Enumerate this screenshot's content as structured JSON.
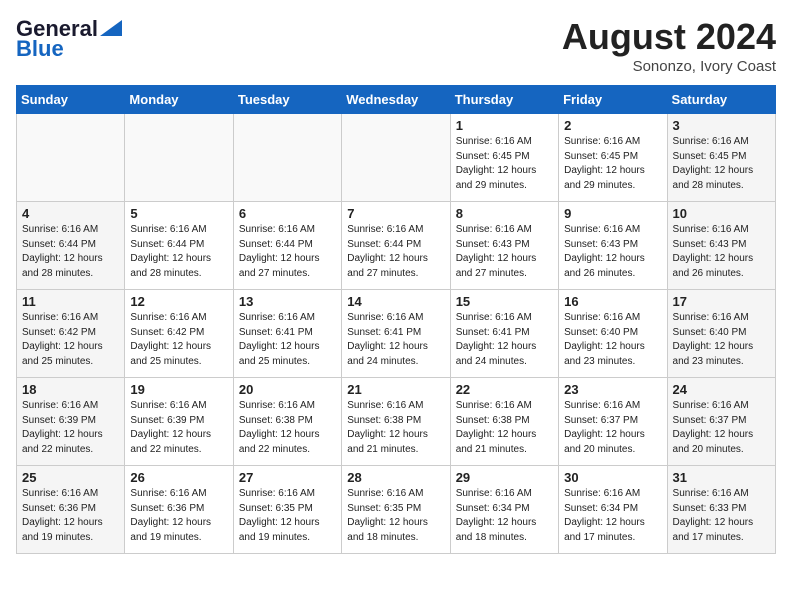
{
  "header": {
    "logo_line1": "General",
    "logo_line2": "Blue",
    "month_year": "August 2024",
    "location": "Sononzo, Ivory Coast"
  },
  "days_of_week": [
    "Sunday",
    "Monday",
    "Tuesday",
    "Wednesday",
    "Thursday",
    "Friday",
    "Saturday"
  ],
  "weeks": [
    [
      {
        "day": "",
        "info": ""
      },
      {
        "day": "",
        "info": ""
      },
      {
        "day": "",
        "info": ""
      },
      {
        "day": "",
        "info": ""
      },
      {
        "day": "1",
        "info": "Sunrise: 6:16 AM\nSunset: 6:45 PM\nDaylight: 12 hours\nand 29 minutes."
      },
      {
        "day": "2",
        "info": "Sunrise: 6:16 AM\nSunset: 6:45 PM\nDaylight: 12 hours\nand 29 minutes."
      },
      {
        "day": "3",
        "info": "Sunrise: 6:16 AM\nSunset: 6:45 PM\nDaylight: 12 hours\nand 28 minutes."
      }
    ],
    [
      {
        "day": "4",
        "info": "Sunrise: 6:16 AM\nSunset: 6:44 PM\nDaylight: 12 hours\nand 28 minutes."
      },
      {
        "day": "5",
        "info": "Sunrise: 6:16 AM\nSunset: 6:44 PM\nDaylight: 12 hours\nand 28 minutes."
      },
      {
        "day": "6",
        "info": "Sunrise: 6:16 AM\nSunset: 6:44 PM\nDaylight: 12 hours\nand 27 minutes."
      },
      {
        "day": "7",
        "info": "Sunrise: 6:16 AM\nSunset: 6:44 PM\nDaylight: 12 hours\nand 27 minutes."
      },
      {
        "day": "8",
        "info": "Sunrise: 6:16 AM\nSunset: 6:43 PM\nDaylight: 12 hours\nand 27 minutes."
      },
      {
        "day": "9",
        "info": "Sunrise: 6:16 AM\nSunset: 6:43 PM\nDaylight: 12 hours\nand 26 minutes."
      },
      {
        "day": "10",
        "info": "Sunrise: 6:16 AM\nSunset: 6:43 PM\nDaylight: 12 hours\nand 26 minutes."
      }
    ],
    [
      {
        "day": "11",
        "info": "Sunrise: 6:16 AM\nSunset: 6:42 PM\nDaylight: 12 hours\nand 25 minutes."
      },
      {
        "day": "12",
        "info": "Sunrise: 6:16 AM\nSunset: 6:42 PM\nDaylight: 12 hours\nand 25 minutes."
      },
      {
        "day": "13",
        "info": "Sunrise: 6:16 AM\nSunset: 6:41 PM\nDaylight: 12 hours\nand 25 minutes."
      },
      {
        "day": "14",
        "info": "Sunrise: 6:16 AM\nSunset: 6:41 PM\nDaylight: 12 hours\nand 24 minutes."
      },
      {
        "day": "15",
        "info": "Sunrise: 6:16 AM\nSunset: 6:41 PM\nDaylight: 12 hours\nand 24 minutes."
      },
      {
        "day": "16",
        "info": "Sunrise: 6:16 AM\nSunset: 6:40 PM\nDaylight: 12 hours\nand 23 minutes."
      },
      {
        "day": "17",
        "info": "Sunrise: 6:16 AM\nSunset: 6:40 PM\nDaylight: 12 hours\nand 23 minutes."
      }
    ],
    [
      {
        "day": "18",
        "info": "Sunrise: 6:16 AM\nSunset: 6:39 PM\nDaylight: 12 hours\nand 22 minutes."
      },
      {
        "day": "19",
        "info": "Sunrise: 6:16 AM\nSunset: 6:39 PM\nDaylight: 12 hours\nand 22 minutes."
      },
      {
        "day": "20",
        "info": "Sunrise: 6:16 AM\nSunset: 6:38 PM\nDaylight: 12 hours\nand 22 minutes."
      },
      {
        "day": "21",
        "info": "Sunrise: 6:16 AM\nSunset: 6:38 PM\nDaylight: 12 hours\nand 21 minutes."
      },
      {
        "day": "22",
        "info": "Sunrise: 6:16 AM\nSunset: 6:38 PM\nDaylight: 12 hours\nand 21 minutes."
      },
      {
        "day": "23",
        "info": "Sunrise: 6:16 AM\nSunset: 6:37 PM\nDaylight: 12 hours\nand 20 minutes."
      },
      {
        "day": "24",
        "info": "Sunrise: 6:16 AM\nSunset: 6:37 PM\nDaylight: 12 hours\nand 20 minutes."
      }
    ],
    [
      {
        "day": "25",
        "info": "Sunrise: 6:16 AM\nSunset: 6:36 PM\nDaylight: 12 hours\nand 19 minutes."
      },
      {
        "day": "26",
        "info": "Sunrise: 6:16 AM\nSunset: 6:36 PM\nDaylight: 12 hours\nand 19 minutes."
      },
      {
        "day": "27",
        "info": "Sunrise: 6:16 AM\nSunset: 6:35 PM\nDaylight: 12 hours\nand 19 minutes."
      },
      {
        "day": "28",
        "info": "Sunrise: 6:16 AM\nSunset: 6:35 PM\nDaylight: 12 hours\nand 18 minutes."
      },
      {
        "day": "29",
        "info": "Sunrise: 6:16 AM\nSunset: 6:34 PM\nDaylight: 12 hours\nand 18 minutes."
      },
      {
        "day": "30",
        "info": "Sunrise: 6:16 AM\nSunset: 6:34 PM\nDaylight: 12 hours\nand 17 minutes."
      },
      {
        "day": "31",
        "info": "Sunrise: 6:16 AM\nSunset: 6:33 PM\nDaylight: 12 hours\nand 17 minutes."
      }
    ]
  ]
}
